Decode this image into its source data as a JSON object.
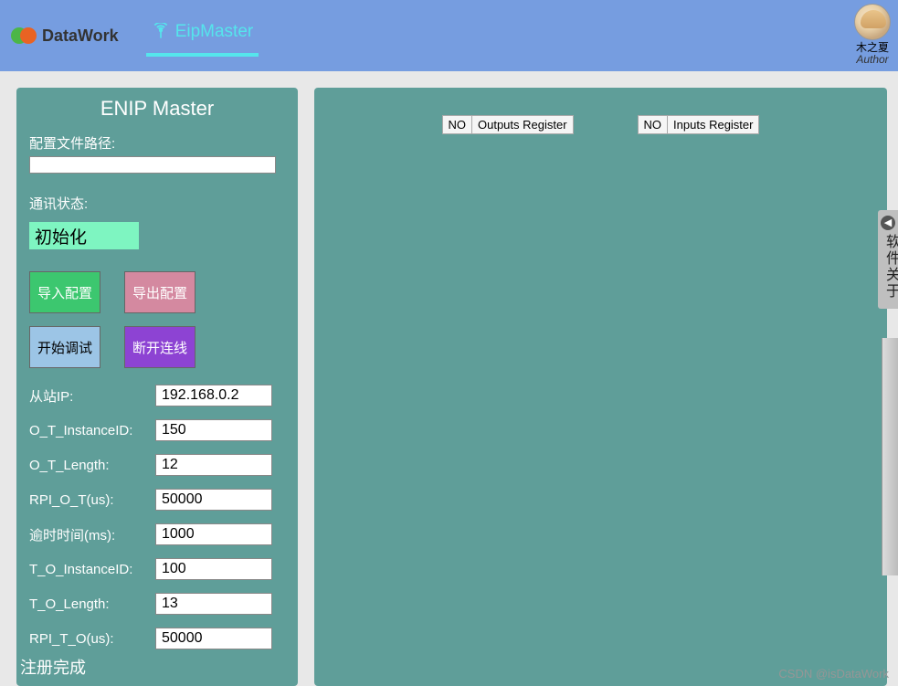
{
  "header": {
    "brand": "DataWork",
    "tab_eipmaster": "EipMaster",
    "author_name": "木之夏",
    "author_sub": "Author"
  },
  "panel": {
    "title": "ENIP Master",
    "config_path_label": "配置文件路径:",
    "config_path_value": "",
    "comm_status_label": "通讯状态:",
    "comm_status_value": "初始化",
    "btn_import": "导入配置",
    "btn_export": "导出配置",
    "btn_debug": "开始调试",
    "btn_disconnect": "断开连线"
  },
  "fields": {
    "slave_ip_label": "从站IP:",
    "slave_ip_value": "192.168.0.2",
    "ot_instance_label": "O_T_InstanceID:",
    "ot_instance_value": "150",
    "ot_length_label": "O_T_Length:",
    "ot_length_value": "12",
    "rpi_ot_label": "RPI_O_T(us):",
    "rpi_ot_value": "50000",
    "timeout_label": "逾时时间(ms):",
    "timeout_value": "1000",
    "to_instance_label": "T_O_InstanceID:",
    "to_instance_value": "100",
    "to_length_label": "T_O_Length:",
    "to_length_value": "13",
    "rpi_to_label": "RPI_T_O(us):",
    "rpi_to_value": "50000"
  },
  "register_status": "注册完成",
  "tables": {
    "outputs_no": "NO",
    "outputs_header": "Outputs Register",
    "inputs_no": "NO",
    "inputs_header": "Inputs Register"
  },
  "drawer": {
    "text": "软件关于"
  },
  "watermark": "CSDN @isDataWork"
}
